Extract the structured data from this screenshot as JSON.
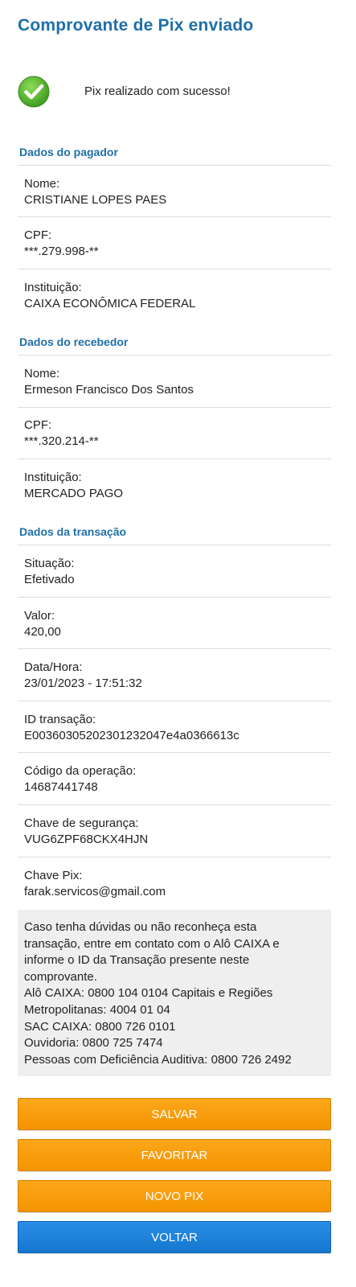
{
  "header": {
    "title": "Comprovante de Pix enviado"
  },
  "status": {
    "message": "Pix realizado com sucesso!",
    "icon": "check-circle-icon",
    "color": "#4caf50"
  },
  "pagador": {
    "section_title": "Dados do pagador",
    "fields": [
      {
        "label": "Nome:",
        "value": "CRISTIANE LOPES PAES"
      },
      {
        "label": "CPF:",
        "value": "***.279.998-**"
      },
      {
        "label": "Instituição:",
        "value": "CAIXA ECONÔMICA FEDERAL"
      }
    ]
  },
  "recebedor": {
    "section_title": "Dados do recebedor",
    "fields": [
      {
        "label": "Nome:",
        "value": "Ermeson Francisco Dos Santos"
      },
      {
        "label": "CPF:",
        "value": "***.320.214-**"
      },
      {
        "label": "Instituição:",
        "value": "MERCADO PAGO"
      }
    ]
  },
  "transacao": {
    "section_title": "Dados da transação",
    "fields": [
      {
        "label": "Situação:",
        "value": "Efetivado"
      },
      {
        "label": "Valor:",
        "value": "420,00"
      },
      {
        "label": "Data/Hora:",
        "value": "23/01/2023 - 17:51:32"
      },
      {
        "label": "ID transação:",
        "value": "E00360305202301232047e4a0366613c"
      },
      {
        "label": "Código da operação:",
        "value": "14687441748"
      },
      {
        "label": "Chave de segurança:",
        "value": "VUG6ZPF68CKX4HJN"
      },
      {
        "label": "Chave Pix:",
        "value": "farak.servicos@gmail.com"
      }
    ]
  },
  "info": {
    "lines": [
      "Caso tenha dúvidas ou não reconheça esta",
      "transação, entre em contato com o Alô CAIXA e",
      "informe o ID da Transação presente neste",
      "comprovante.",
      "Alô CAIXA: 0800 104 0104 Capitais e Regiões",
      "Metropolitanas: 4004 01 04",
      "SAC CAIXA: 0800 726 0101",
      "Ouvidoria: 0800 725 7474",
      "Pessoas com Deficiência Auditiva: 0800 726 2492"
    ]
  },
  "buttons": {
    "salvar": "SALVAR",
    "favoritar": "FAVORITAR",
    "novo_pix": "NOVO PIX",
    "voltar": "VOLTAR",
    "colors": {
      "orange": "#f7a01a",
      "blue": "#1e83da"
    }
  }
}
